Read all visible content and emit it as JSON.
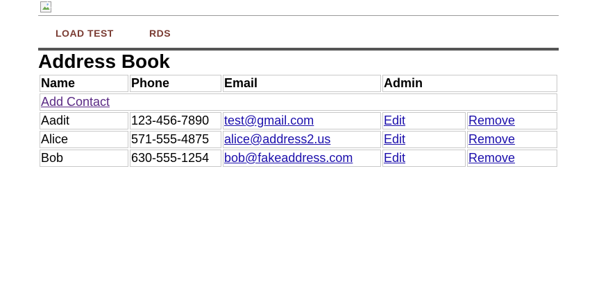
{
  "header": {
    "logo_icon": "broken-image-icon"
  },
  "nav": {
    "items": [
      {
        "label": "LOAD TEST"
      },
      {
        "label": "RDS"
      }
    ],
    "color": "#7a3b32"
  },
  "main": {
    "title": "Address Book",
    "table": {
      "headers": {
        "name": "Name",
        "phone": "Phone",
        "email": "Email",
        "admin": "Admin"
      },
      "add_contact_label": "Add Contact",
      "rows": [
        {
          "name": "Aadit",
          "phone": "123-456-7890",
          "email": "test@gmail.com",
          "edit": "Edit",
          "remove": "Remove"
        },
        {
          "name": "Alice",
          "phone": "571-555-4875",
          "email": "alice@address2.us",
          "edit": "Edit",
          "remove": "Remove"
        },
        {
          "name": "Bob",
          "phone": "630-555-1254",
          "email": "bob@fakeaddress.com",
          "edit": "Edit",
          "remove": "Remove"
        }
      ]
    },
    "link_color": "#1a0dab",
    "visited_link_color": "#5a2a84"
  }
}
